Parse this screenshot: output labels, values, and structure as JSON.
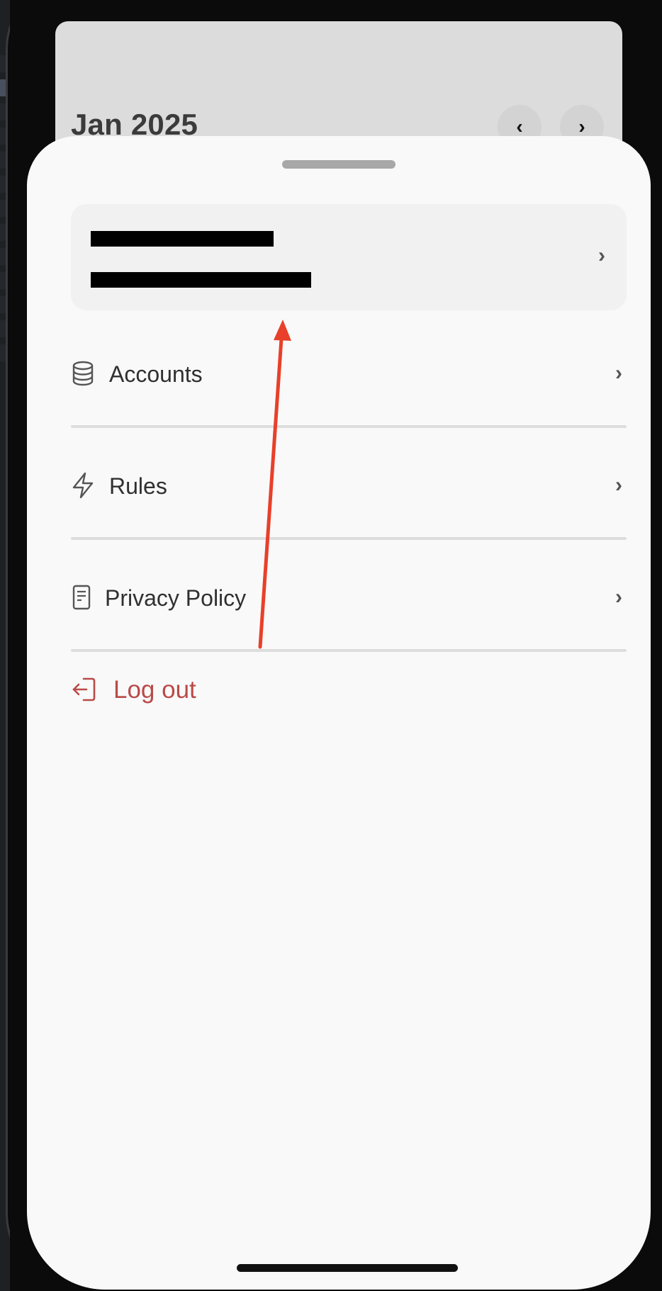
{
  "background_header": {
    "month_label": "Jan 2025",
    "prev_icon": "chevron-left-icon",
    "next_icon": "chevron-right-icon"
  },
  "profile": {
    "name": "redacted",
    "email": "redacted",
    "chevron_icon": "chevron-right-icon"
  },
  "menu": {
    "items": [
      {
        "label": "Accounts",
        "icon": "database-icon"
      },
      {
        "label": "Rules",
        "icon": "lightning-icon"
      },
      {
        "label": "Privacy Policy",
        "icon": "document-icon"
      }
    ],
    "logout": {
      "label": "Log out",
      "icon": "logout-icon",
      "color": "#b94a48"
    }
  },
  "annotation": {
    "type": "arrow",
    "color": "#e8402a"
  }
}
